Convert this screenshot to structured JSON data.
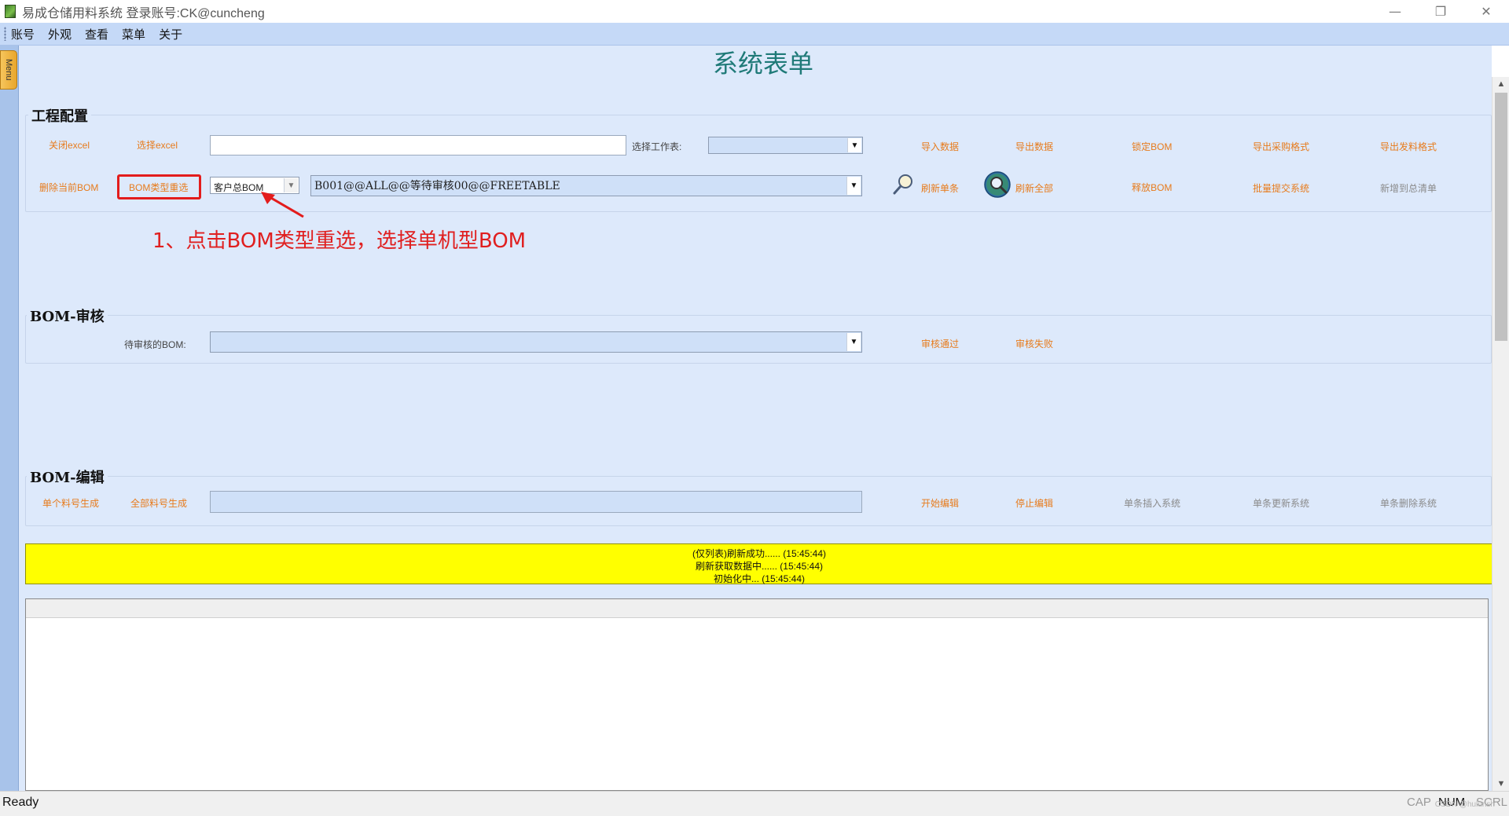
{
  "window": {
    "title": "易成仓储用料系统 登录账号:CK@cuncheng",
    "minimize": "—",
    "restore": "❐",
    "close": "✕"
  },
  "menubar": [
    "账号",
    "外观",
    "查看",
    "菜单",
    "关于"
  ],
  "sidebar": {
    "tab_label": "Menu"
  },
  "form": {
    "title": "系统表单"
  },
  "engineering": {
    "group_title": "工程配置",
    "row1": {
      "close_excel": "关闭excel",
      "select_excel": "选择excel",
      "sheet_label": "选择工作表:",
      "sheet_value": "",
      "import_data": "导入数据",
      "export_data": "导出数据",
      "lock_bom": "锁定BOM",
      "export_purchase": "导出采购格式",
      "export_issue": "导出发料格式"
    },
    "row2": {
      "delete_bom": "删除当前BOM",
      "bom_type_reselect": "BOM类型重选",
      "bom_type_value": "客户总BOM",
      "bom_value": "B001@@ALL@@等待审核00@@FREETABLE",
      "refresh_single": "刷新单条",
      "refresh_all": "刷新全部",
      "release_bom": "释放BOM",
      "batch_submit": "批量提交系统",
      "add_to_list": "新增到总清单"
    }
  },
  "annotation": {
    "text": "1、点击BOM类型重选，选择单机型BOM",
    "color": "#e01f1f"
  },
  "bom_review": {
    "group_title": "BOM-审核",
    "pending_label": "待审核的BOM:",
    "pending_value": "",
    "approve": "审核通过",
    "reject": "审核失败"
  },
  "bom_edit": {
    "group_title": "BOM-编辑",
    "single_gen": "单个料号生成",
    "all_gen": "全部料号生成",
    "edit_value": "",
    "start_edit": "开始编辑",
    "stop_edit": "停止编辑",
    "insert_single": "单条插入系统",
    "update_single": "单条更新系统",
    "delete_single": "单条删除系统"
  },
  "log": {
    "lines": [
      "(仅列表)刷新成功...... (15:45:44)",
      "刷新获取数据中...... (15:45:44)",
      "初始化中... (15:45:44)"
    ],
    "bg": "#ffff00"
  },
  "statusbar": {
    "left": "Ready",
    "cap": "CAP",
    "num": "NUM",
    "scrl": "SCRL",
    "watermark": "CSDN @hulunsh"
  },
  "colors": {
    "accent_link": "#e77b1c",
    "form_title": "#1f7a78",
    "panel_bg": "#dde9fb"
  }
}
